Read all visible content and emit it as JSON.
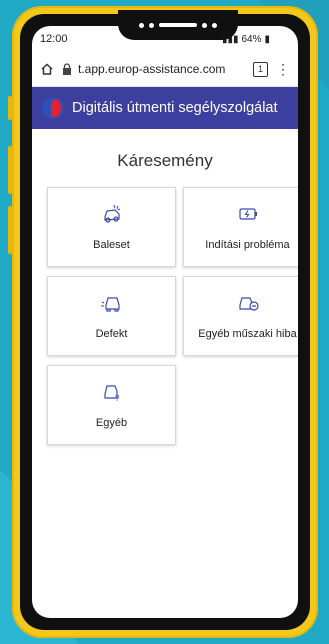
{
  "status_bar": {
    "time": "12:00",
    "battery": "64%"
  },
  "browser": {
    "url": "t.app.europ-assistance.com",
    "tab_count": "1"
  },
  "header": {
    "title": "Digitális útmenti segélyszolgálat"
  },
  "page": {
    "title": "Káresemény"
  },
  "options": [
    {
      "label": "Baleset",
      "icon": "car-crash-icon"
    },
    {
      "label": "Indítási probléma",
      "icon": "battery-icon"
    },
    {
      "label": "Defekt",
      "icon": "flat-tire-icon"
    },
    {
      "label": "Egyéb műszaki hiba",
      "icon": "car-fault-icon"
    },
    {
      "label": "Egyéb",
      "icon": "car-question-icon"
    }
  ]
}
